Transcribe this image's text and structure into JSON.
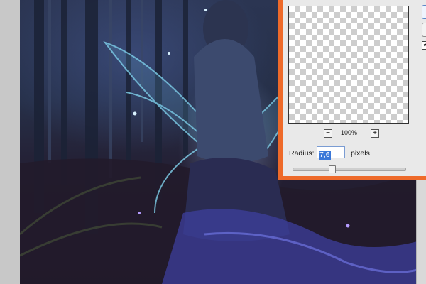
{
  "dialog": {
    "zoom_out_label": "−",
    "zoom_in_label": "+",
    "zoom_level": "100%",
    "preview_checked_mark": "✔",
    "radius_label": "Radius:",
    "radius_value": "7,6",
    "radius_unit": "pixels",
    "slider_fraction": 0.34
  },
  "colors": {
    "dialog_border": "#ee6a2a",
    "selection": "#3b78d8"
  },
  "icons": {
    "zoom_out": "minus-icon",
    "zoom_in": "plus-icon",
    "preview_check": "checkmark-icon"
  }
}
